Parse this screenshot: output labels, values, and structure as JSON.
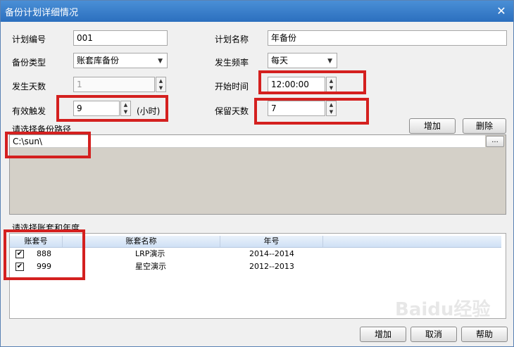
{
  "window": {
    "title": "备份计划详细情况",
    "close_glyph": "✕"
  },
  "form": {
    "plan_no_label": "计划编号",
    "plan_no_value": "001",
    "plan_name_label": "计划名称",
    "plan_name_value": "年备份",
    "backup_type_label": "备份类型",
    "backup_type_value": "账套库备份",
    "frequency_label": "发生频率",
    "frequency_value": "每天",
    "days_label": "发生天数",
    "days_value": "1",
    "start_time_label": "开始时间",
    "start_time_value": "12:00:00",
    "trigger_label": "有效触发",
    "trigger_value": "9",
    "trigger_unit": "(小时)",
    "keep_days_label": "保留天数",
    "keep_days_value": "7"
  },
  "path_section": {
    "label": "请选择备份路径",
    "add_label": "增加",
    "delete_label": "删除",
    "path_value": "C:\\sun\\",
    "browse_label": "..."
  },
  "account_section": {
    "label": "请选择账套和年度",
    "headers": [
      "账套号",
      "账套名称",
      "年号"
    ],
    "rows": [
      {
        "checked": true,
        "no": "888",
        "name": "LRP演示",
        "year": "2014--2014"
      },
      {
        "checked": true,
        "no": "999",
        "name": "星空演示",
        "year": "2012--2013"
      }
    ]
  },
  "footer": {
    "add_label": "增加",
    "cancel_label": "取消",
    "help_label": "帮助"
  },
  "watermark": "Baidu经验",
  "colors": {
    "title_bar": "#2c6fbe",
    "highlight_box": "#d4201f",
    "path_panel": "#d4d0c8"
  }
}
